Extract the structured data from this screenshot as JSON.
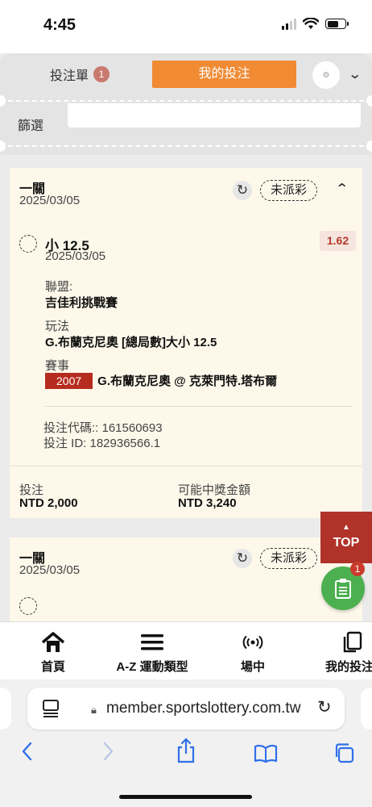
{
  "status_bar": {
    "time": "4:45"
  },
  "header": {
    "bet_slip_label": "投注單",
    "bet_slip_count": "1",
    "my_bets_label": "我的投注"
  },
  "filter": {
    "label": "篩選"
  },
  "bets": [
    {
      "type": "一關",
      "date": "2025/03/05",
      "status": "未派彩",
      "selection": "小 12.5",
      "selection_date": "2025/03/05",
      "odds": "1.62",
      "league_label": "聯盟:",
      "league": "吉佳利挑戰賽",
      "market_label": "玩法",
      "market": "G.布蘭克尼奧 [總局數]大小 12.5",
      "event_label": "賽事",
      "event_code": "2007",
      "event": "G.布蘭克尼奧 @ 克萊門特.塔布爾",
      "bet_code": "投注代碼:: 161560693",
      "bet_id": "投注 ID: 182936566.1",
      "stake_label": "投注",
      "stake": "NTD 2,000",
      "payout_label": "可能中獎金額",
      "payout": "NTD 3,240"
    },
    {
      "type": "一關",
      "date": "2025/03/05",
      "status": "未派彩"
    }
  ],
  "floating": {
    "top_label": "TOP",
    "fab_badge": "1"
  },
  "bottom_nav": [
    {
      "label": "首頁",
      "icon": "home-icon"
    },
    {
      "label": "A-Z 運動類型",
      "icon": "menu-icon"
    },
    {
      "label": "場中",
      "icon": "live-icon"
    },
    {
      "label": "我的投注",
      "icon": "copy-icon"
    }
  ],
  "browser": {
    "url": "member.sportslottery.com.tw"
  }
}
